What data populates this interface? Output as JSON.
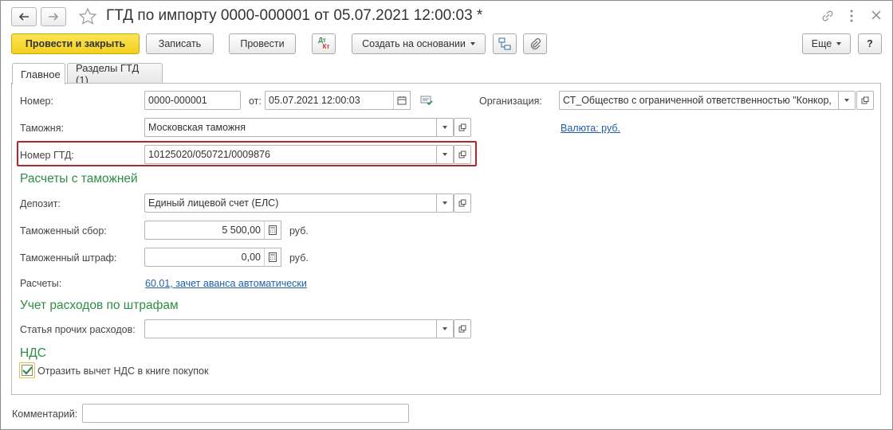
{
  "window": {
    "title": "ГТД по импорту 0000-000001 от 05.07.2021 12:00:03 *"
  },
  "toolbar": {
    "post_close": "Провести и закрыть",
    "save": "Записать",
    "post": "Провести",
    "dt_kt_top": "Дт",
    "dt_kt_bottom": "Кт",
    "create_based": "Создать на основании",
    "more": "Еще",
    "help": "?"
  },
  "tabs": [
    {
      "label": "Главное"
    },
    {
      "label": "Разделы ГТД (1)"
    }
  ],
  "form": {
    "number_label": "Номер:",
    "number_value": "0000-000001",
    "date_label": "от:",
    "date_value": "05.07.2021 12:00:03",
    "org_label": "Организация:",
    "org_value": "СТ_Общество с ограниченной ответственностью \"Конкор,",
    "customs_label": "Таможня:",
    "customs_value": "Московская таможня",
    "currency_link": "Валюта: руб.",
    "gtd_label": "Номер ГТД:",
    "gtd_value": "10125020/050721/0009876"
  },
  "customs_section": {
    "title": "Расчеты с таможней",
    "deposit_label": "Депозит:",
    "deposit_value": "Единый лицевой счет (ЕЛС)",
    "fee_label": "Таможенный сбор:",
    "fee_value": "5 500,00",
    "fee_unit": "руб.",
    "fine_label": "Таможенный штраф:",
    "fine_value": "0,00",
    "fine_unit": "руб.",
    "settlements_label": "Расчеты:",
    "settlements_link": "60.01, зачет аванса автоматически"
  },
  "fines_section": {
    "title": "Учет расходов по штрафам",
    "expense_label": "Статья прочих расходов:",
    "expense_value": ""
  },
  "vat_section": {
    "title": "НДС",
    "checkbox_label": "Отразить вычет НДС в книге покупок",
    "checked": true
  },
  "comment": {
    "label": "Комментарий:",
    "value": ""
  },
  "colors": {
    "accent_yellow": "#f3cf1f",
    "section_green": "#2f8d46",
    "link_blue": "#1f5fa8",
    "highlight_red": "#b3262b"
  }
}
